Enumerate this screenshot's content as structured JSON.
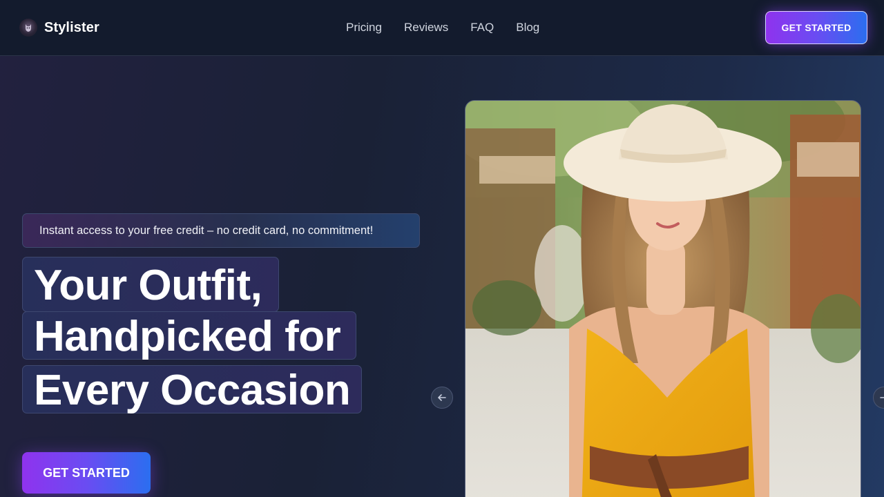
{
  "brand": {
    "name": "Stylister",
    "logo_icon": "wolf-logo-icon"
  },
  "nav": {
    "links": [
      {
        "label": "Pricing"
      },
      {
        "label": "Reviews"
      },
      {
        "label": "FAQ"
      },
      {
        "label": "Blog"
      }
    ],
    "cta_label": "GET STARTED"
  },
  "hero": {
    "badge_text": "Instant access to your free credit – no credit card, no commitment!",
    "headline_lines": [
      "Your Outfit,",
      "Handpicked for",
      "Every Occasion"
    ],
    "cta_label": "GET STARTED",
    "image_alt_icon": "model-photo",
    "carousel": {
      "prev_icon": "arrow-left-icon",
      "next_icon": "arrow-right-icon"
    }
  },
  "colors": {
    "accent_start": "#8f33ee",
    "accent_end": "#2b6ef0",
    "nav_background": "#131b2d",
    "page_background": "#1a2136"
  }
}
